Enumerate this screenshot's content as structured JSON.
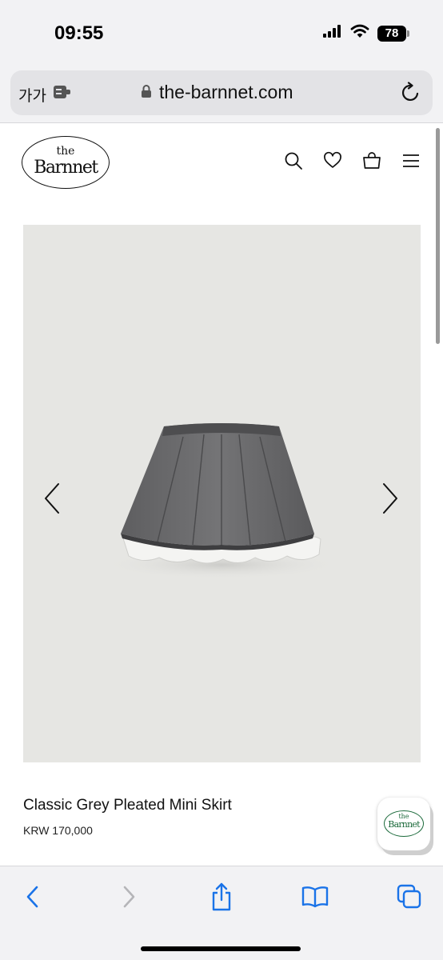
{
  "status_bar": {
    "time": "09:55",
    "battery": "78"
  },
  "browser": {
    "text_size_label": "가가",
    "url": "the-barnnet.com"
  },
  "site": {
    "logo_the": "the",
    "logo_name": "Barnnet"
  },
  "product": {
    "name": "Classic Grey Pleated Mini Skirt",
    "price": "KRW 170,000"
  },
  "floating_badge": {
    "logo_the": "the",
    "logo_name": "Barnnet"
  },
  "colors": {
    "accent_blue": "#1a73e8",
    "brand_green": "#1d6b3c",
    "image_bg": "#e6e6e3"
  },
  "icons": {
    "header": [
      "search-icon",
      "heart-icon",
      "bag-icon",
      "menu-icon"
    ],
    "toolbar": [
      "back-icon",
      "forward-icon",
      "share-icon",
      "bookmarks-icon",
      "tabs-icon"
    ]
  }
}
